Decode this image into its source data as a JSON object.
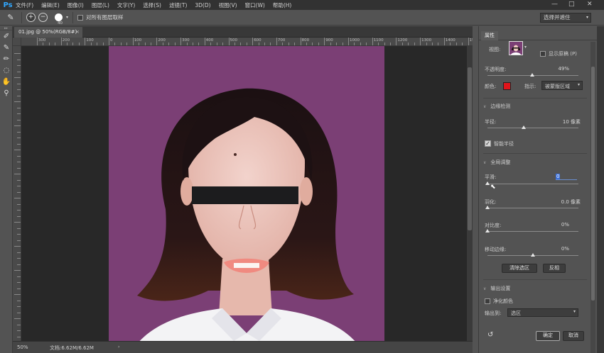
{
  "app": {
    "logo": "Ps"
  },
  "menu": [
    "文件(F)",
    "编辑(E)",
    "图像(I)",
    "图层(L)",
    "文字(Y)",
    "选择(S)",
    "滤镜(T)",
    "3D(D)",
    "视图(V)",
    "窗口(W)",
    "帮助(H)"
  ],
  "window_controls": {
    "minimize": "—",
    "maximize": "□",
    "close": "✕"
  },
  "options": {
    "brush_size": "40",
    "sample_all_layers_label": "对所有图层取样",
    "sample_all_layers_checked": false,
    "select_mask_label": "选择并遮住"
  },
  "tools": [
    "refine-edge-brush",
    "brush",
    "object-selection",
    "lasso",
    "hand",
    "zoom"
  ],
  "document": {
    "tab_title": "01.jpg @ 50%(RGB/8#)",
    "tab_close": "×",
    "ruler_labels": [
      "400",
      "300",
      "200",
      "100",
      "0",
      "100",
      "200",
      "300",
      "400",
      "500",
      "600",
      "700",
      "800",
      "900",
      "1000",
      "1100",
      "1200",
      "1300",
      "1400",
      "1500",
      "1600"
    ],
    "status_zoom": "50%",
    "status_doc": "文档:6.62M/6.62M",
    "status_arrow": "›"
  },
  "properties": {
    "tab": "属性",
    "view_label": "视图:",
    "show_original_label": "显示原稿 (P)",
    "show_original_checked": false,
    "opacity_label": "不透明度:",
    "opacity_value": "49%",
    "opacity_fraction": 0.49,
    "color_label": "颜色:",
    "color_swatch": "#e0141a",
    "indicate_label": "指示:",
    "indicate_value": "被蒙版区域",
    "edge_detect_header": "边缘检测",
    "radius_label": "半径:",
    "radius_value": "10 像素",
    "radius_fraction": 0.4,
    "smart_radius_label": "智能半径",
    "smart_radius_checked": true,
    "global_header": "全局调整",
    "smooth_label": "平滑:",
    "smooth_value": "0",
    "feather_label": "羽化:",
    "feather_value": "0.0 像素",
    "contrast_label": "对比度:",
    "contrast_value": "0%",
    "shift_edge_label": "移动边缘:",
    "shift_edge_value": "0%",
    "shift_edge_fraction": 0.5,
    "clear_selection_label": "清除选区",
    "invert_label": "反相",
    "output_header": "输出设置",
    "decontaminate_label": "净化颜色",
    "decontaminate_checked": false,
    "output_to_label": "输出到:",
    "output_to_value": "选区",
    "ok_label": "确定",
    "cancel_label": "取消"
  },
  "colors": {
    "canvas_bg": "#7b3f75",
    "ps_blue": "#31a8ff",
    "bar": "#1c1c1e"
  }
}
